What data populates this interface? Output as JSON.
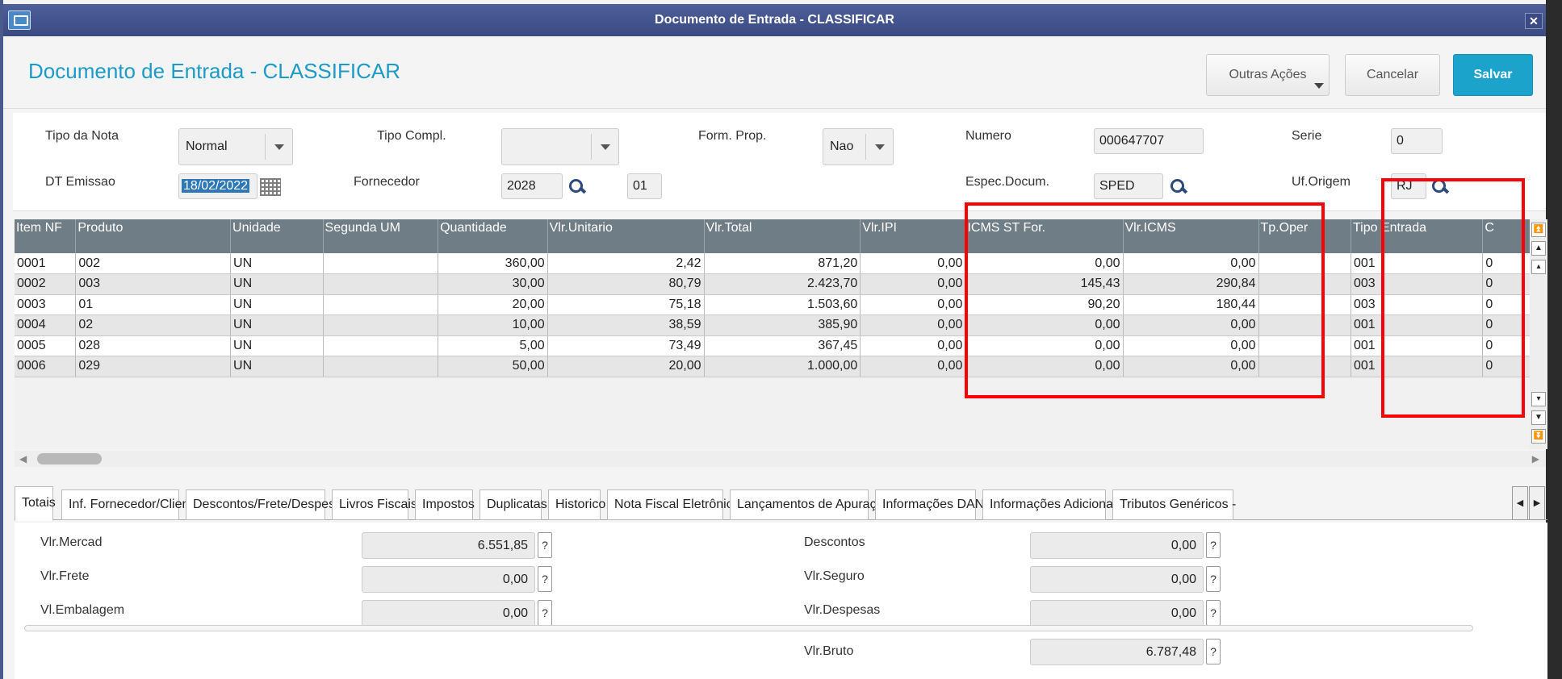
{
  "window": {
    "title": "Documento de Entrada - CLASSIFICAR",
    "close_glyph": "✕"
  },
  "header": {
    "title": "Documento de Entrada - CLASSIFICAR",
    "outras_acoes": "Outras Ações",
    "cancelar": "Cancelar",
    "salvar": "Salvar"
  },
  "form": {
    "tipo_nota_label": "Tipo da Nota",
    "tipo_nota_value": "Normal",
    "tipo_compl_label": "Tipo Compl.",
    "tipo_compl_value": "",
    "form_prop_label": "Form. Prop.",
    "form_prop_value": "Nao",
    "numero_label": "Numero",
    "numero_value": "000647707",
    "serie_label": "Serie",
    "serie_value": "0",
    "dt_emissao_label": "DT Emissao",
    "dt_emissao_value": "18/02/2022",
    "fornecedor_label": "Fornecedor",
    "fornecedor_value": "2028",
    "loja_value": "01",
    "espec_label": "Espec.Docum.",
    "espec_value": "SPED",
    "uf_label": "Uf.Origem",
    "uf_value": "RJ"
  },
  "grid": {
    "columns": [
      "Item NF",
      "Produto",
      "Unidade",
      "Segunda UM",
      "Quantidade",
      "Vlr.Unitario",
      "Vlr.Total",
      "Vlr.IPI",
      "ICMS ST For.",
      "Vlr.ICMS",
      "Tp.Oper",
      "Tipo Entrada",
      "C"
    ],
    "rows": [
      [
        "0001",
        "002",
        "UN",
        "",
        "360,00",
        "2,42",
        "871,20",
        "0,00",
        "0,00",
        "0,00",
        "",
        "001",
        "0"
      ],
      [
        "0002",
        "003",
        "UN",
        "",
        "30,00",
        "80,79",
        "2.423,70",
        "0,00",
        "145,43",
        "290,84",
        "",
        "003",
        "0"
      ],
      [
        "0003",
        "01",
        "UN",
        "",
        "20,00",
        "75,18",
        "1.503,60",
        "0,00",
        "90,20",
        "180,44",
        "",
        "003",
        "0"
      ],
      [
        "0004",
        "02",
        "UN",
        "",
        "10,00",
        "38,59",
        "385,90",
        "0,00",
        "0,00",
        "0,00",
        "",
        "001",
        "0"
      ],
      [
        "0005",
        "028",
        "UN",
        "",
        "5,00",
        "73,49",
        "367,45",
        "0,00",
        "0,00",
        "0,00",
        "",
        "001",
        "0"
      ],
      [
        "0006",
        "029",
        "UN",
        "",
        "50,00",
        "20,00",
        "1.000,00",
        "0,00",
        "0,00",
        "0,00",
        "",
        "001",
        "0"
      ]
    ]
  },
  "tabs": [
    "Totais",
    "Inf. Fornecedor/Cliente",
    "Descontos/Frete/Despesas",
    "Livros Fiscais",
    "Impostos",
    "Duplicatas",
    "Historico",
    "Nota Fiscal Eletrônica",
    "Lançamentos de Apuração",
    "Informações DANFE",
    "Informações Adicionais",
    "Tributos Genéricos -"
  ],
  "totais": {
    "vlr_mercad_label": "Vlr.Mercad",
    "vlr_mercad": "6.551,85",
    "vlr_frete_label": "Vlr.Frete",
    "vlr_frete": "0,00",
    "vl_embalagem_label": "Vl.Embalagem",
    "vl_embalagem": "0,00",
    "descontos_label": "Descontos",
    "descontos": "0,00",
    "vlr_seguro_label": "Vlr.Seguro",
    "vlr_seguro": "0,00",
    "vlr_despesas_label": "Vlr.Despesas",
    "vlr_despesas": "0,00",
    "vlr_bruto_label": "Vlr.Bruto",
    "vlr_bruto": "6.787,48",
    "help_glyph": "?"
  },
  "colors": {
    "title_bar": "#4e5f9a",
    "accent": "#1b9bc6",
    "grid_header": "#6f7d86",
    "annotation": "#ff0000"
  }
}
